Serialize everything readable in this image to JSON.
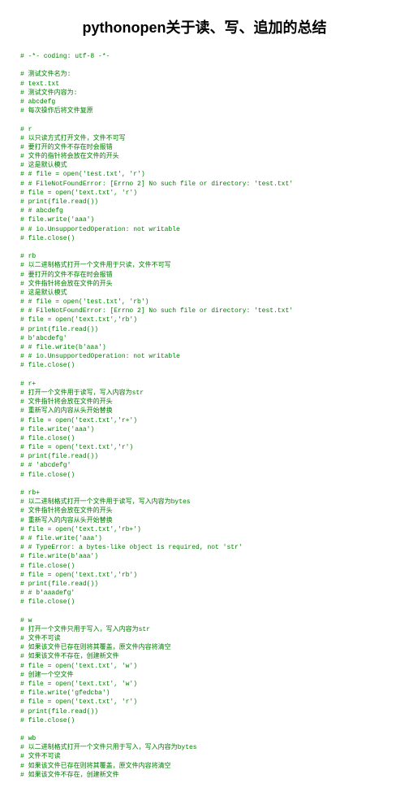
{
  "title": "pythonopen关于读、写、追加的总结",
  "lines": [
    "# -*- coding: utf-8 -*-",
    "",
    "# 测试文件名为:",
    "# text.txt",
    "# 测试文件内容为:",
    "# abcdefg",
    "# 每次操作后将文件复原",
    "",
    "# r",
    "# 以只读方式打开文件，文件不可写",
    "# 要打开的文件不存在时会报错",
    "# 文件的指针将会放在文件的开头",
    "# 这是默认模式",
    "# # file = open('test.txt', 'r')",
    "# # FileNotFoundError: [Errno 2] No such file or directory: 'test.txt'",
    "# file = open('text.txt', 'r')",
    "# print(file.read())",
    "# # abcdefg",
    "# file.write('aaa')",
    "# # io.UnsupportedOperation: not writable",
    "# file.close()",
    "",
    "# rb",
    "# 以二进制格式打开一个文件用于只读，文件不可写",
    "# 要打开的文件不存在时会报错",
    "# 文件指针将会放在文件的开头",
    "# 这是默认模式",
    "# # file = open('test.txt', 'rb')",
    "# # FileNotFoundError: [Errno 2] No such file or directory: 'test.txt'",
    "# file = open('text.txt','rb')",
    "# print(file.read())",
    "# b'abcdefg'",
    "# # file.write(b'aaa')",
    "# # io.UnsupportedOperation: not writable",
    "# file.close()",
    "",
    "# r+",
    "# 打开一个文件用于读写，写入内容为str",
    "# 文件指针将会放在文件的开头",
    "# 重新写入的内容从头开始替换",
    "# file = open('text.txt','r+')",
    "# file.write('aaa')",
    "# file.close()",
    "# file = open('text.txt','r')",
    "# print(file.read())",
    "# # 'abcdefg'",
    "# file.close()",
    "",
    "# rb+",
    "# 以二进制格式打开一个文件用于读写，写入内容为bytes",
    "# 文件指针将会放在文件的开头",
    "# 重新写入的内容从头开始替换",
    "# file = open('text.txt','rb+')",
    "# # file.write('aaa')",
    "# # TypeError: a bytes-like object is required, not 'str'",
    "# file.write(b'aaa')",
    "# file.close()",
    "# file = open('text.txt','rb')",
    "# print(file.read())",
    "# # b'aaadefg'",
    "# file.close()",
    "",
    "# w",
    "# 打开一个文件只用于写入，写入内容为str",
    "# 文件不可读",
    "# 如果该文件已存在则将其覆盖，原文件内容将清空",
    "# 如果该文件不存在，创建新文件",
    "# file = open('text.txt', 'w')",
    "# 创建一个空文件",
    "# file = open('text.txt', 'w')",
    "# file.write('gfedcba')",
    "# file = open('text.txt', 'r')",
    "# print(file.read())",
    "# file.close()",
    "",
    "# wb",
    "# 以二进制格式打开一个文件只用于写入，写入内容为bytes",
    "# 文件不可读",
    "# 如果该文件已存在则将其覆盖，原文件内容将清空",
    "# 如果该文件不存在，创建新文件"
  ]
}
